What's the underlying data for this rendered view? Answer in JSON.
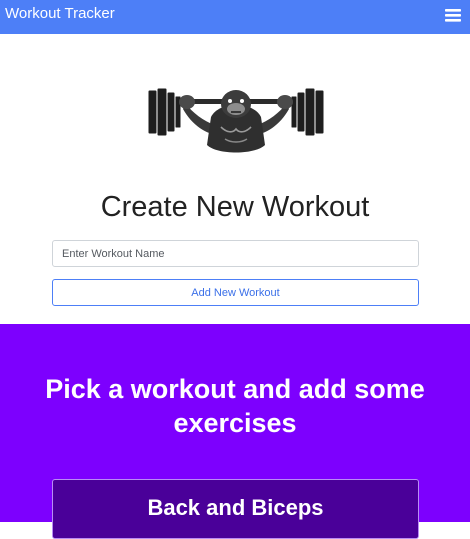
{
  "navbar": {
    "brand": "Workout Tracker",
    "menu_icon": "hamburger-menu-icon",
    "background": "#4d7ff7"
  },
  "hero": {
    "logo_icon": "gorilla-barbell-logo",
    "title": "Create New Workout",
    "input_placeholder": "Enter Workout Name",
    "input_value": "",
    "add_button_label": "Add New Workout"
  },
  "workouts_section": {
    "background": "#7d00fe",
    "title": "Pick a workout and add some exercises",
    "items": [
      {
        "label": "Back and Biceps"
      }
    ]
  }
}
